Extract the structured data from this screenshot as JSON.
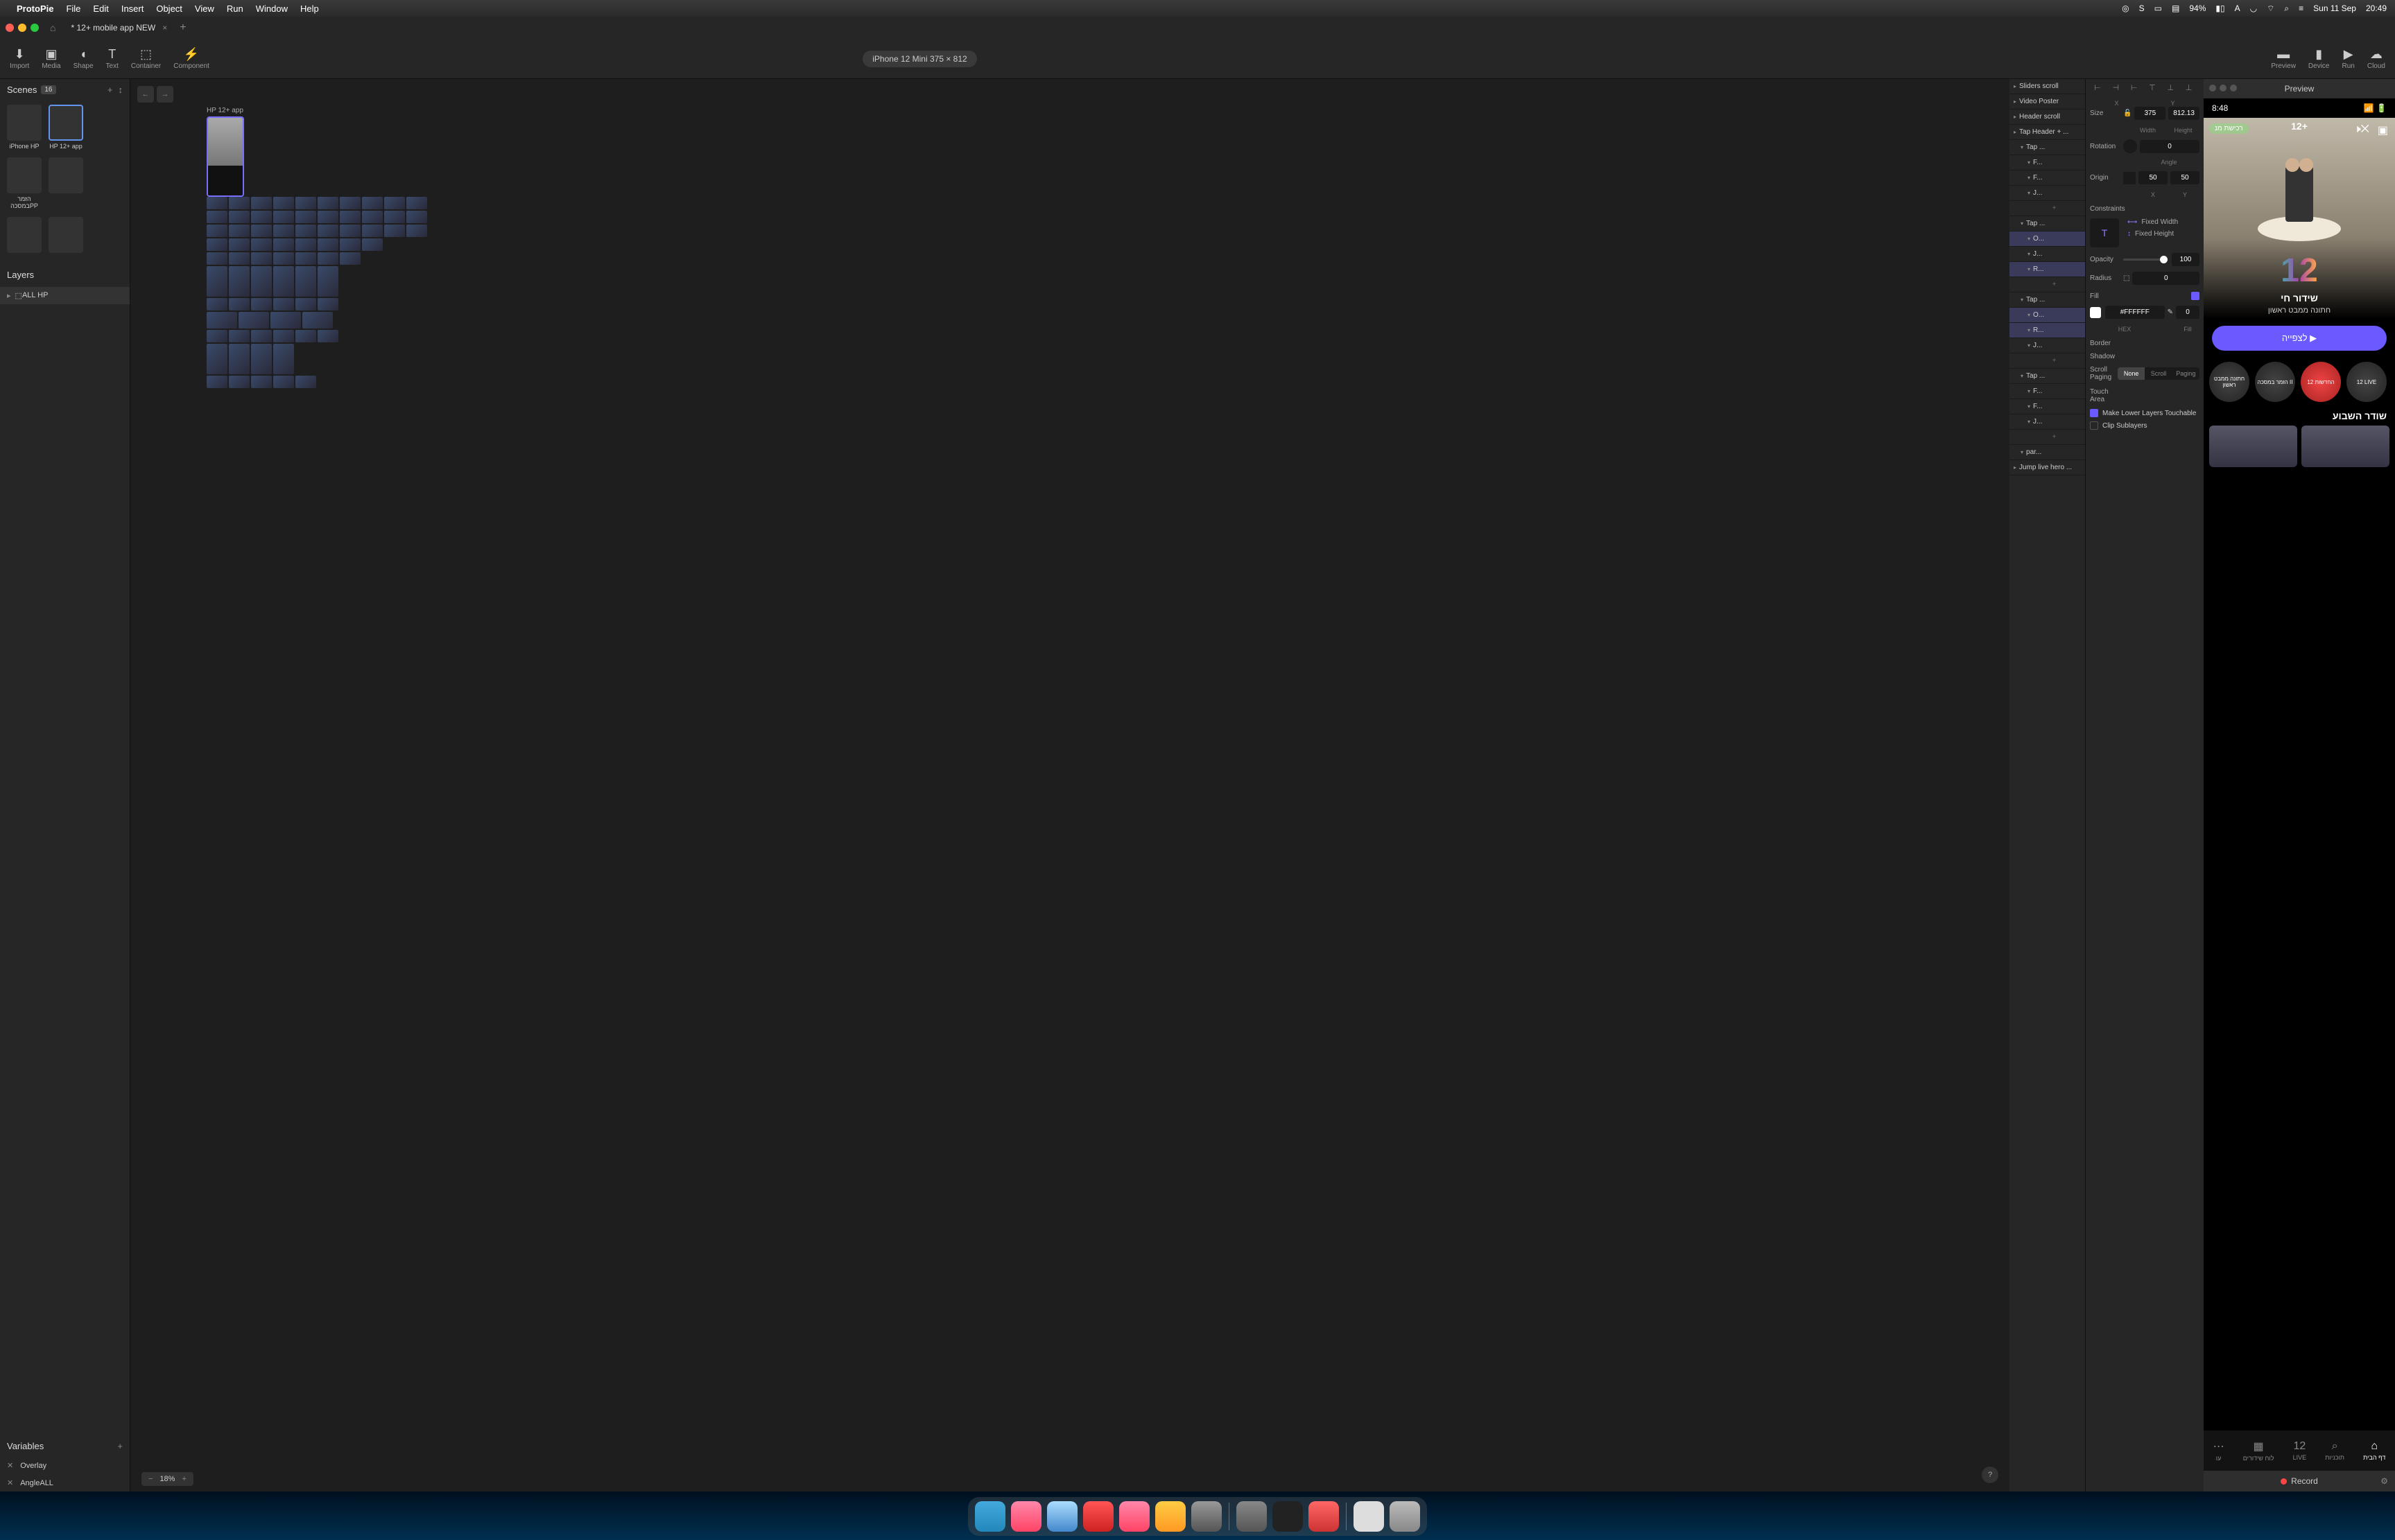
{
  "menubar": {
    "app": "ProtoPie",
    "items": [
      "File",
      "Edit",
      "Insert",
      "Object",
      "View",
      "Run",
      "Window",
      "Help"
    ],
    "battery": "94%",
    "date": "Sun 11 Sep",
    "time": "20:49"
  },
  "tab": {
    "title": "* 12+ mobile app NEW"
  },
  "toolbar": {
    "import": "Import",
    "media": "Media",
    "shape": "Shape",
    "text": "Text",
    "container": "Container",
    "component": "Component",
    "device": "iPhone 12 Mini  375 × 812",
    "preview": "Preview",
    "device_r": "Device",
    "run": "Run",
    "cloud": "Cloud"
  },
  "scenes": {
    "title": "Scenes",
    "count": "16",
    "items": [
      "iPhone HP",
      "HP 12+ app",
      "הזמר במסכהPP"
    ]
  },
  "layers": {
    "title": "Layers",
    "item": "ALL HP"
  },
  "variables": {
    "title": "Variables",
    "items": [
      "Overlay",
      "AngleALL"
    ]
  },
  "canvas": {
    "artboard": "HP 12+ app",
    "zoom": "18%"
  },
  "interactions": {
    "rows": [
      {
        "label": "Sliders scroll",
        "lvl": 0
      },
      {
        "label": "Video Poster",
        "lvl": 0
      },
      {
        "label": "Header scroll",
        "lvl": 0
      },
      {
        "label": "Tap Header + ...",
        "lvl": 0
      },
      {
        "label": "Tap ...",
        "lvl": 1
      },
      {
        "label": "F...",
        "lvl": 2
      },
      {
        "label": "F...",
        "lvl": 2
      },
      {
        "label": "J...",
        "lvl": 2
      },
      {
        "label": "+",
        "lvl": 2,
        "add": true
      },
      {
        "label": "Tap ...",
        "lvl": 1
      },
      {
        "label": "O...",
        "lvl": 2,
        "sel": true
      },
      {
        "label": "J...",
        "lvl": 2
      },
      {
        "label": "R...",
        "lvl": 2,
        "sel": true
      },
      {
        "label": "+",
        "lvl": 2,
        "add": true
      },
      {
        "label": "Tap ...",
        "lvl": 1
      },
      {
        "label": "O...",
        "lvl": 2,
        "sel": true
      },
      {
        "label": "R...",
        "lvl": 2,
        "sel": true
      },
      {
        "label": "J...",
        "lvl": 2
      },
      {
        "label": "+",
        "lvl": 2,
        "add": true
      },
      {
        "label": "Tap ...",
        "lvl": 1
      },
      {
        "label": "F...",
        "lvl": 2
      },
      {
        "label": "F...",
        "lvl": 2
      },
      {
        "label": "J...",
        "lvl": 2
      },
      {
        "label": "+",
        "lvl": 2,
        "add": true
      },
      {
        "label": "par...",
        "lvl": 1
      },
      {
        "label": "Jump live hero ...",
        "lvl": 0
      }
    ]
  },
  "props": {
    "x_sub": "X",
    "y_sub": "Y",
    "size": "Size",
    "width": "375",
    "height": "812.13",
    "w_sub": "Width",
    "h_sub": "Height",
    "rotation": "Rotation",
    "rot_val": "0",
    "angle_sub": "Angle",
    "origin": "Origin",
    "ox": "50",
    "oy": "50",
    "constraints": "Constraints",
    "fixedw": "Fixed Width",
    "fixedh": "Fixed Height",
    "opacity": "Opacity",
    "op_val": "100",
    "radius": "Radius",
    "rad_val": "0",
    "fill": "Fill",
    "fill_hex": "#FFFFFF",
    "fill_op": "0",
    "hex_sub": "HEX",
    "fill_sub": "Fill",
    "border": "Border",
    "shadow": "Shadow",
    "scroll": "Scroll Paging",
    "none": "None",
    "scr": "Scroll",
    "paging": "Paging",
    "touch": "Touch Area",
    "lower": "Make Lower Layers Touchable",
    "clip": "Clip Sublayers"
  },
  "preview": {
    "title": "Preview",
    "status_time": "8:48",
    "badge": "רכישת מנ",
    "logo": "12+",
    "big": "12",
    "hero_title": "שידור חי",
    "hero_sub": "חתונה ממבט ראשון",
    "watch": "לצפייה  ▶",
    "circles": [
      "חתונה ממבט ראשון",
      "הזמר במסכה II",
      "12 החדשות",
      "12 LIVE"
    ],
    "section": "שודר השבוע",
    "tabs": [
      "עו",
      "לוח שידורים",
      "LIVE",
      "תוכניות",
      "דף הבית"
    ],
    "record": "Record"
  }
}
